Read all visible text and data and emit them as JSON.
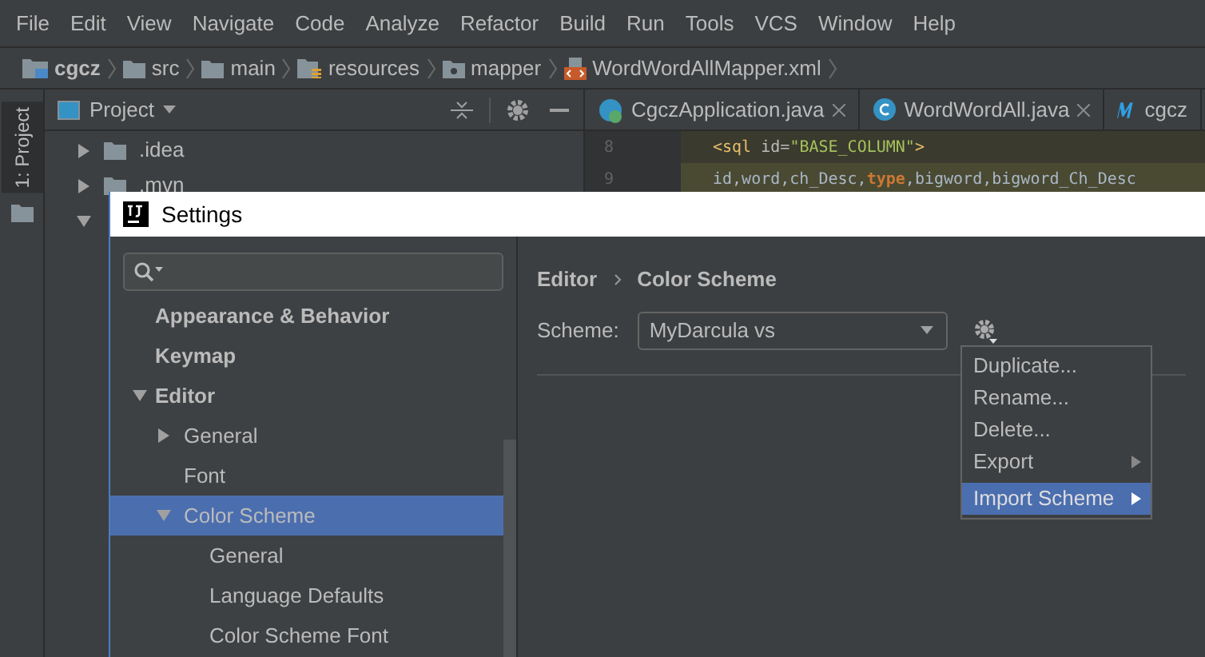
{
  "menu": [
    "File",
    "Edit",
    "View",
    "Navigate",
    "Code",
    "Analyze",
    "Refactor",
    "Build",
    "Run",
    "Tools",
    "VCS",
    "Window",
    "Help"
  ],
  "breadcrumb": [
    {
      "label": "cgcz",
      "kind": "project"
    },
    {
      "label": "src",
      "kind": "folder"
    },
    {
      "label": "main",
      "kind": "folder"
    },
    {
      "label": "resources",
      "kind": "resources"
    },
    {
      "label": "mapper",
      "kind": "package"
    },
    {
      "label": "WordWordAllMapper.xml",
      "kind": "xml"
    }
  ],
  "tool_strip": {
    "label": "1: Project"
  },
  "project_panel": {
    "title": "Project",
    "tree": [
      {
        "label": ".idea",
        "expanded": false
      },
      {
        "label": ".mvn",
        "expanded": false
      },
      {
        "expanded": true
      }
    ]
  },
  "editor_tabs": [
    {
      "label": "CgczApplication.java",
      "kind": "spring",
      "closable": true
    },
    {
      "label": "WordWordAll.java",
      "kind": "class",
      "closable": true
    },
    {
      "label": "cgcz",
      "kind": "m",
      "closable": false
    }
  ],
  "code_lines": [
    {
      "number": "8",
      "highlighted": false,
      "segments": [
        {
          "text": "<sql",
          "kind": "tag"
        },
        {
          "text": " id=",
          "kind": "attr"
        },
        {
          "text": "\"BASE_COLUMN\"",
          "kind": "string"
        },
        {
          "text": ">",
          "kind": "tag"
        }
      ]
    },
    {
      "number": "9",
      "highlighted": true,
      "segments": [
        {
          "text": "id,word,ch_Desc,",
          "kind": "plain"
        },
        {
          "text": "type",
          "kind": "keyword"
        },
        {
          "text": ",bigword,bigword_Ch_Desc",
          "kind": "plain"
        }
      ]
    }
  ],
  "settings": {
    "title": "Settings",
    "tree": [
      {
        "label": "Appearance & Behavior",
        "bold": true,
        "selected": false
      },
      {
        "label": "Keymap",
        "bold": true,
        "selected": false
      },
      {
        "label": "Editor",
        "bold": true,
        "expanded": true,
        "selected": false,
        "children": [
          {
            "label": "General",
            "bold": false,
            "expanded": false,
            "selected": false
          },
          {
            "label": "Font",
            "bold": false,
            "selected": false
          },
          {
            "label": "Color Scheme",
            "bold": false,
            "expanded": true,
            "selected": true,
            "children": [
              {
                "label": "General",
                "bold": false,
                "selected": false
              },
              {
                "label": "Language Defaults",
                "bold": false,
                "selected": false
              },
              {
                "label": "Color Scheme Font",
                "bold": false,
                "selected": false
              }
            ]
          }
        ]
      }
    ],
    "path": [
      "Editor",
      "Color Scheme"
    ],
    "scheme_label": "Scheme:",
    "scheme_value": "MyDarcula vs",
    "popup": [
      {
        "label": "Duplicate...",
        "submenu": false,
        "selected": false
      },
      {
        "label": "Rename...",
        "submenu": false,
        "selected": false
      },
      {
        "label": "Delete...",
        "submenu": false,
        "selected": false
      },
      {
        "label": "Export",
        "submenu": true,
        "selected": false
      },
      {
        "label": "Import Scheme",
        "submenu": true,
        "selected": true
      }
    ]
  }
}
